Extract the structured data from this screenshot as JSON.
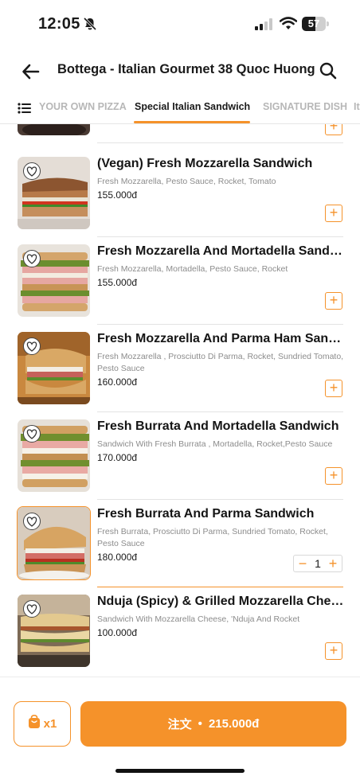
{
  "status": {
    "time": "12:05",
    "battery": "57",
    "battery_level": 0.57,
    "icons": [
      "bell-off-icon",
      "signal-icon",
      "wifi-icon",
      "battery-icon"
    ]
  },
  "header": {
    "title": "Bottega - Italian Gourmet 38 Quoc Huong",
    "back_icon": "arrow-left-icon",
    "search_icon": "search-icon"
  },
  "tabs": [
    {
      "label": "YOUR OWN PIZZA",
      "active": false
    },
    {
      "label": "Special Italian Sandwich",
      "active": true
    },
    {
      "label": "SIGNATURE DISH",
      "active": false
    },
    {
      "label": "It",
      "active": false
    }
  ],
  "items": [
    {
      "name": "(Vegan) Fresh Mozzarella Sandwich",
      "desc": "Fresh Mozzarella, Pesto Sauce, Rocket, Tomato",
      "price": "155.000đ",
      "quantity": 0
    },
    {
      "name": "Fresh Mozzarella And Mortadella Sandwich",
      "desc": "Fresh Mozzarella, Mortadella, Pesto Sauce, Rocket",
      "price": "155.000đ",
      "quantity": 0
    },
    {
      "name": "Fresh Mozzarella And Parma Ham Sandwich",
      "desc": "Fresh Mozzarella , Prosciutto Di Parma, Rocket, Sundried Tomato, Pesto Sauce",
      "price": "160.000đ",
      "quantity": 0
    },
    {
      "name": "Fresh Burrata And Mortadella Sandwich",
      "desc": "Sandwich With Fresh Burrata , Mortadella, Rocket,Pesto Sauce",
      "price": "170.000đ",
      "quantity": 0
    },
    {
      "name": "Fresh Burrata And Parma Sandwich",
      "desc": "Fresh Burrata, Prosciutto Di Parma, Sundried Tomato, Rocket, Pesto Sauce",
      "price": "180.000đ",
      "quantity": 1
    },
    {
      "name": "Nduja (Spicy) & Grilled Mozzarella Cheese Sandwich",
      "desc": "Sandwich With Mozzarella Cheese, 'Nduja And Rocket",
      "price": "100.000đ",
      "quantity": 0
    }
  ],
  "buttons": {
    "add": "+",
    "minus": "−",
    "plus": "+"
  },
  "cart": {
    "count": "x1",
    "order_label": "注文",
    "separator": "•",
    "total": "215.000đ"
  },
  "colors": {
    "accent": "#f5922a",
    "text": "#1a1a1a",
    "muted": "#8c8c8c"
  }
}
